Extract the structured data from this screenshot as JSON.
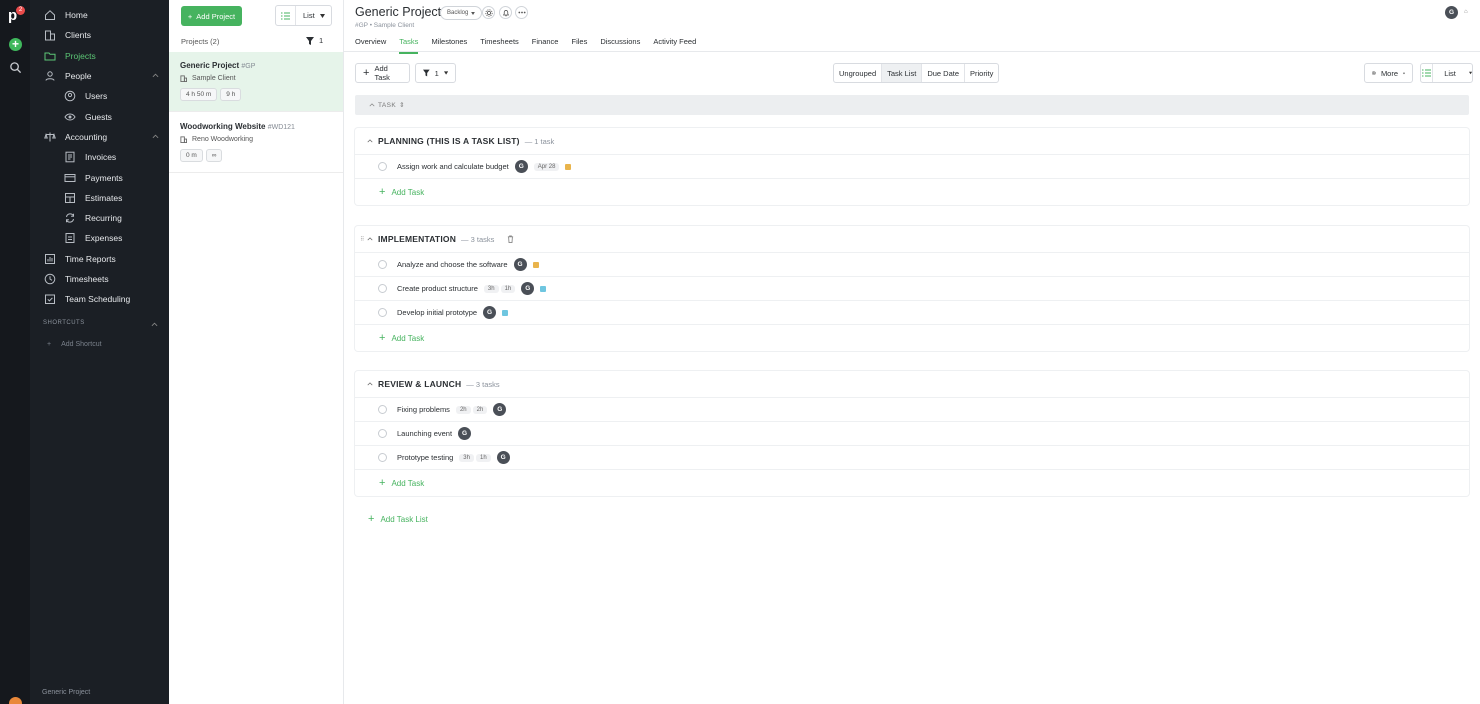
{
  "rail": {
    "logo": "p",
    "badge": "2"
  },
  "nav": {
    "items": [
      {
        "label": "Home"
      },
      {
        "label": "Clients"
      },
      {
        "label": "Projects"
      },
      {
        "label": "People"
      },
      {
        "label": "Users"
      },
      {
        "label": "Guests"
      },
      {
        "label": "Accounting"
      },
      {
        "label": "Invoices"
      },
      {
        "label": "Payments"
      },
      {
        "label": "Estimates"
      },
      {
        "label": "Recurring"
      },
      {
        "label": "Expenses"
      },
      {
        "label": "Time Reports"
      },
      {
        "label": "Timesheets"
      },
      {
        "label": "Team Scheduling"
      }
    ],
    "shortcuts_label": "SHORTCUTS",
    "add_shortcut": "Add Shortcut",
    "footer": "Generic Project"
  },
  "project_list": {
    "add_button": "Add Project",
    "view_label": "List",
    "count_label": "Projects (2)",
    "filter_count": "1",
    "projects": [
      {
        "name": "Generic Project",
        "code": "#GP",
        "client": "Sample Client",
        "times": [
          "4 h 50 m",
          "9 h"
        ]
      },
      {
        "name": "Woodworking Website",
        "code": "#WD121",
        "client": "Reno Woodworking",
        "times": [
          "0 m",
          "∞"
        ]
      }
    ]
  },
  "header": {
    "title": "Generic Project",
    "status": "Backlog",
    "meta": "#GP  •  Sample Client",
    "tabs": [
      "Overview",
      "Tasks",
      "Milestones",
      "Timesheets",
      "Finance",
      "Files",
      "Discussions",
      "Activity Feed"
    ],
    "user_initial": "G"
  },
  "toolbar": {
    "add_task": "Add Task",
    "filter_count": "1",
    "grouping": [
      "Ungrouped",
      "Task List",
      "Due Date",
      "Priority"
    ],
    "more": "More",
    "view": "List"
  },
  "column_header": "TASK",
  "task_lists": [
    {
      "name": "PLANNING (THIS IS A TASK LIST)",
      "count": "— 1 task",
      "tasks": [
        {
          "name": "Assign work and calculate budget",
          "chips": [],
          "avatar": "G",
          "due": "Apr 28",
          "color": "#e9b44c"
        }
      ]
    },
    {
      "name": "IMPLEMENTATION",
      "count": "— 3 tasks",
      "tasks": [
        {
          "name": "Analyze and choose the software",
          "chips": [],
          "avatar": "G",
          "due": "",
          "color": "#e9b44c"
        },
        {
          "name": "Create product structure",
          "chips": [
            "3h",
            "1h"
          ],
          "avatar": "G",
          "due": "",
          "color": "#6fc6e0"
        },
        {
          "name": "Develop initial prototype",
          "chips": [],
          "avatar": "G",
          "due": "",
          "color": "#6fc6e0"
        }
      ]
    },
    {
      "name": "REVIEW & LAUNCH",
      "count": "— 3 tasks",
      "tasks": [
        {
          "name": "Fixing problems",
          "chips": [
            "2h",
            "2h"
          ],
          "avatar": "G",
          "due": "",
          "color": ""
        },
        {
          "name": "Launching event",
          "chips": [],
          "avatar": "G",
          "due": "",
          "color": ""
        },
        {
          "name": "Prototype testing",
          "chips": [
            "3h",
            "1h"
          ],
          "avatar": "G",
          "due": "",
          "color": ""
        }
      ]
    }
  ],
  "add_task_label": "Add Task",
  "add_task_list_label": "Add Task List",
  "colors": {
    "accent": "#46b35f",
    "sidebar": "#1b1f25",
    "rail": "#15181d"
  }
}
